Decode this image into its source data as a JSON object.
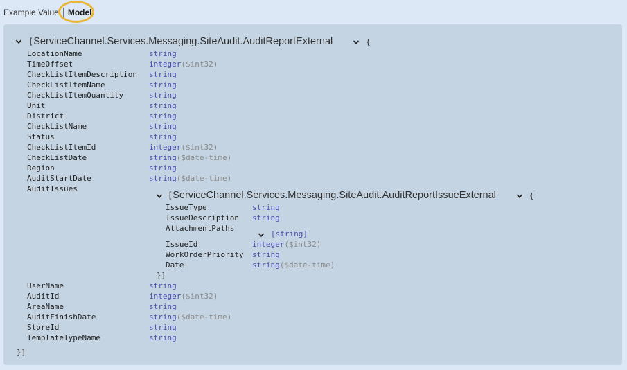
{
  "tabs": {
    "example_value": "Example Value",
    "model": "Model"
  },
  "model": {
    "open_bracket": "[",
    "title": "ServiceChannel.Services.Messaging.SiteAudit.AuditReportExternal",
    "open_brace": "{",
    "close": "}]",
    "properties_top": [
      {
        "name": "LocationName",
        "type": "string",
        "format": ""
      },
      {
        "name": "TimeOffset",
        "type": "integer",
        "format": "($int32)"
      },
      {
        "name": "CheckListItemDescription",
        "type": "string",
        "format": ""
      },
      {
        "name": "CheckListItemName",
        "type": "string",
        "format": ""
      },
      {
        "name": "CheckListItemQuantity",
        "type": "string",
        "format": ""
      },
      {
        "name": "Unit",
        "type": "string",
        "format": ""
      },
      {
        "name": "District",
        "type": "string",
        "format": ""
      },
      {
        "name": "CheckListName",
        "type": "string",
        "format": ""
      },
      {
        "name": "Status",
        "type": "string",
        "format": ""
      },
      {
        "name": "CheckListItemId",
        "type": "integer",
        "format": "($int32)"
      },
      {
        "name": "CheckListDate",
        "type": "string",
        "format": "($date-time)"
      },
      {
        "name": "Region",
        "type": "string",
        "format": ""
      },
      {
        "name": "AuditStartDate",
        "type": "string",
        "format": "($date-time)"
      },
      {
        "name": "AuditIssues",
        "type": "",
        "format": ""
      }
    ],
    "audit_issues": {
      "open_bracket": "[",
      "title": "ServiceChannel.Services.Messaging.SiteAudit.AuditReportIssueExternal",
      "open_brace": "{",
      "close": "}]",
      "properties": [
        {
          "name": "IssueType",
          "type": "string",
          "format": ""
        },
        {
          "name": "IssueDescription",
          "type": "string",
          "format": ""
        },
        {
          "name": "AttachmentPaths",
          "type": "",
          "format": ""
        },
        {
          "name": "IssueId",
          "type": "integer",
          "format": "($int32)"
        },
        {
          "name": "WorkOrderPriority",
          "type": "string",
          "format": ""
        },
        {
          "name": "Date",
          "type": "string",
          "format": "($date-time)"
        }
      ],
      "attachment_paths_type": "[string]"
    },
    "properties_bottom": [
      {
        "name": "UserName",
        "type": "string",
        "format": ""
      },
      {
        "name": "AuditId",
        "type": "integer",
        "format": "($int32)"
      },
      {
        "name": "AreaName",
        "type": "string",
        "format": ""
      },
      {
        "name": "AuditFinishDate",
        "type": "string",
        "format": "($date-time)"
      },
      {
        "name": "StoreId",
        "type": "string",
        "format": ""
      },
      {
        "name": "TemplateTypeName",
        "type": "string",
        "format": ""
      }
    ]
  }
}
